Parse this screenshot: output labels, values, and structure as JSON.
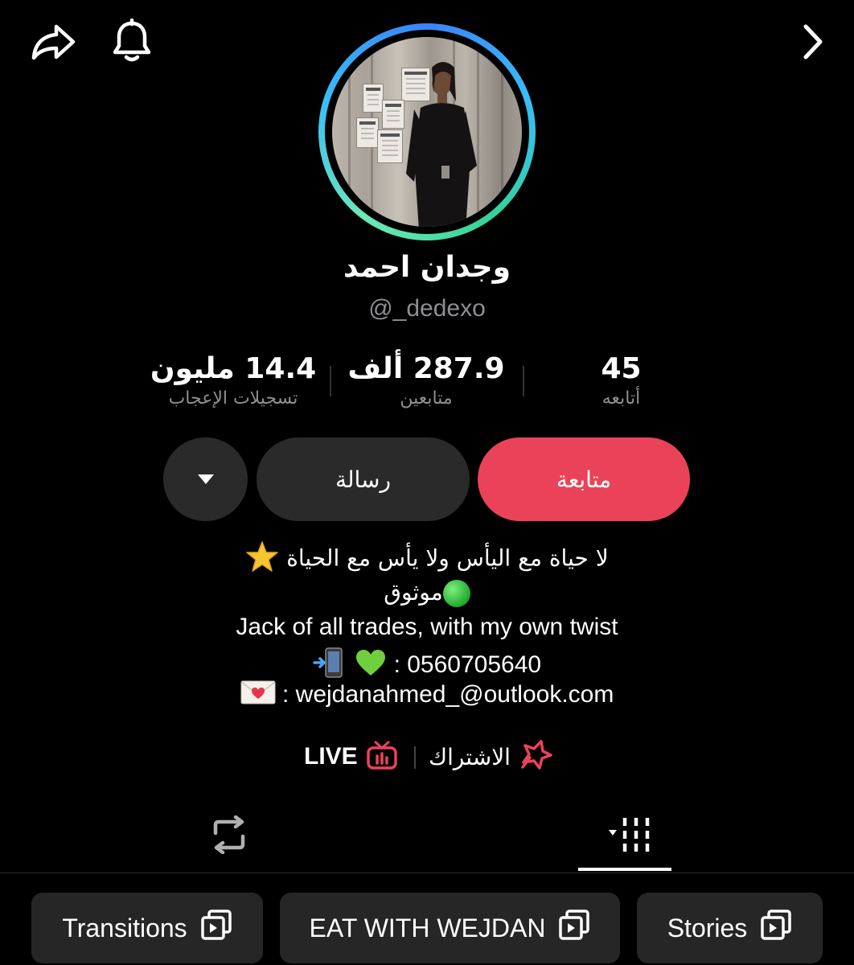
{
  "topbar": {
    "share_icon": "share-arrow-icon",
    "bell_icon": "bell-icon",
    "forward_icon": "chevron-right-icon"
  },
  "profile": {
    "display_name": "وجدان احمد",
    "username": "@_dedexo"
  },
  "stats": {
    "likes": {
      "value": "14.4 مليون",
      "label": "تسجيلات الإعجاب"
    },
    "followers": {
      "value": "287.9 ألف",
      "label": "متابعين"
    },
    "following": {
      "value": "45",
      "label": "أتابعه"
    }
  },
  "actions": {
    "follow_label": "متابعة",
    "message_label": "رسالة",
    "more_icon": "caret-down-icon"
  },
  "bio": {
    "line1": "لا حياة مع اليأس ولا يأس مع الحياة",
    "line2": "موثوق",
    "line3": "Jack of all trades, with my own twist",
    "line4_text": ": 0560705640",
    "line5_text": ": wejdanahmed_@outlook.com"
  },
  "links": {
    "subscribe_label": "الاشتراك",
    "live_label": "LIVE"
  },
  "tabs": {
    "repost_icon": "repost-icon",
    "videos_icon": "grid-videos-icon",
    "active": "videos"
  },
  "playlists": [
    {
      "label": "Transitions"
    },
    {
      "label": "EAT WITH WEJDAN"
    },
    {
      "label": "Stories"
    }
  ],
  "colors": {
    "background": "#000000",
    "follow_button": "#ea4359",
    "secondary_button": "#2a2a2a",
    "muted_text": "#8e8e93",
    "chip_background": "#262626"
  }
}
